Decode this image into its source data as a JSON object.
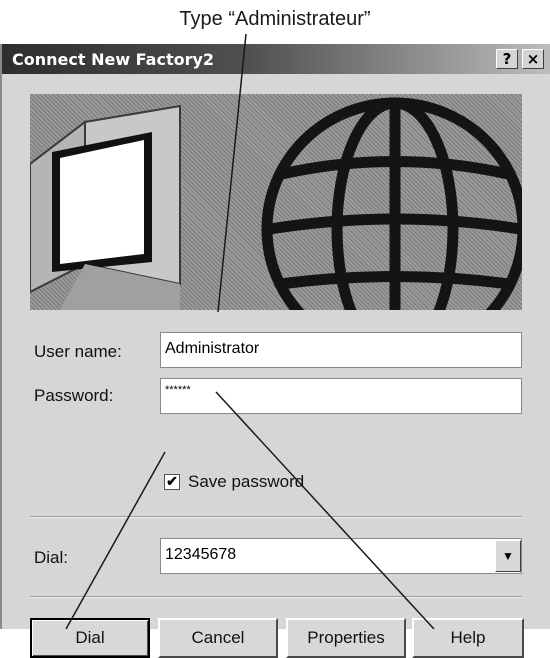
{
  "callouts": {
    "top": "Type “Administrateur”"
  },
  "window": {
    "title": "Connect New Factory2",
    "help_button": "?",
    "close_button": "×"
  },
  "banner": {
    "icons": [
      "computer-monitor-icon",
      "globe-icon"
    ]
  },
  "form": {
    "user_name_label": "User name:",
    "user_name_value": "Administrator",
    "password_label": "Password:",
    "password_value": "******",
    "save_password_label": "Save password",
    "save_password_checked": true,
    "dial_label": "Dial:",
    "dial_value": "12345678"
  },
  "buttons": {
    "dial": "Dial",
    "cancel": "Cancel",
    "properties": "Properties",
    "help": "Help"
  },
  "colors": {
    "dialog_bg": "#d6d6d6",
    "titlebar_dark": "#2e2e2e",
    "titlebar_light": "#bdbdbd"
  }
}
